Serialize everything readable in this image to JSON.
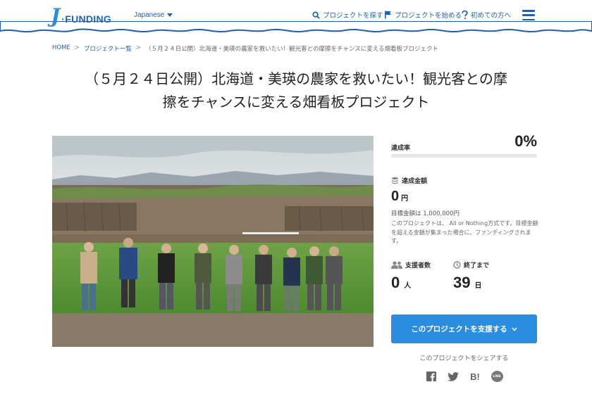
{
  "header": {
    "logo_j": "J",
    "logo_text": "·FUNDING",
    "language": "Japanese",
    "nav": {
      "search": "プロジェクトを探す",
      "start": "プロジェクトを始める",
      "help": "初めての方へ"
    }
  },
  "breadcrumb": {
    "home": "HOME",
    "list": "プロジェクト一覧",
    "current": "（５月２４日公開）北海道・美瑛の農家を救いたい！観光客との摩擦をチャンスに変える畑看板プロジェクト"
  },
  "project": {
    "title_line1": "（５月２４日公開）北海道・美瑛の農家を救いたい！観光客との摩",
    "title_line2": "擦をチャンスに変える畑看板プロジェクト"
  },
  "stats": {
    "rate_label": "達成率",
    "rate_value": "0%",
    "progress_fraction": 0,
    "amount_label": "達成金額",
    "amount_value": "0",
    "amount_unit": "円",
    "goal": "目標金額は 1,000,000円",
    "description": "このプロジェクトは、 All or Nothing方式です。目標金額を超える金額が集まった場合に、ファンディングされます。",
    "backers_label": "支援者数",
    "backers_value": "0",
    "backers_unit": "人",
    "days_label": "終了まで",
    "days_value": "39",
    "days_unit": "日"
  },
  "actions": {
    "support_button": "このプロジェクトを支援する",
    "share_text": "このプロジェクトをシェアする",
    "line_icon_text": "LINE",
    "hatena_text": "B!"
  },
  "colors": {
    "brand_blue": "#2a8ee0",
    "nav_blue": "#1f5fae"
  }
}
